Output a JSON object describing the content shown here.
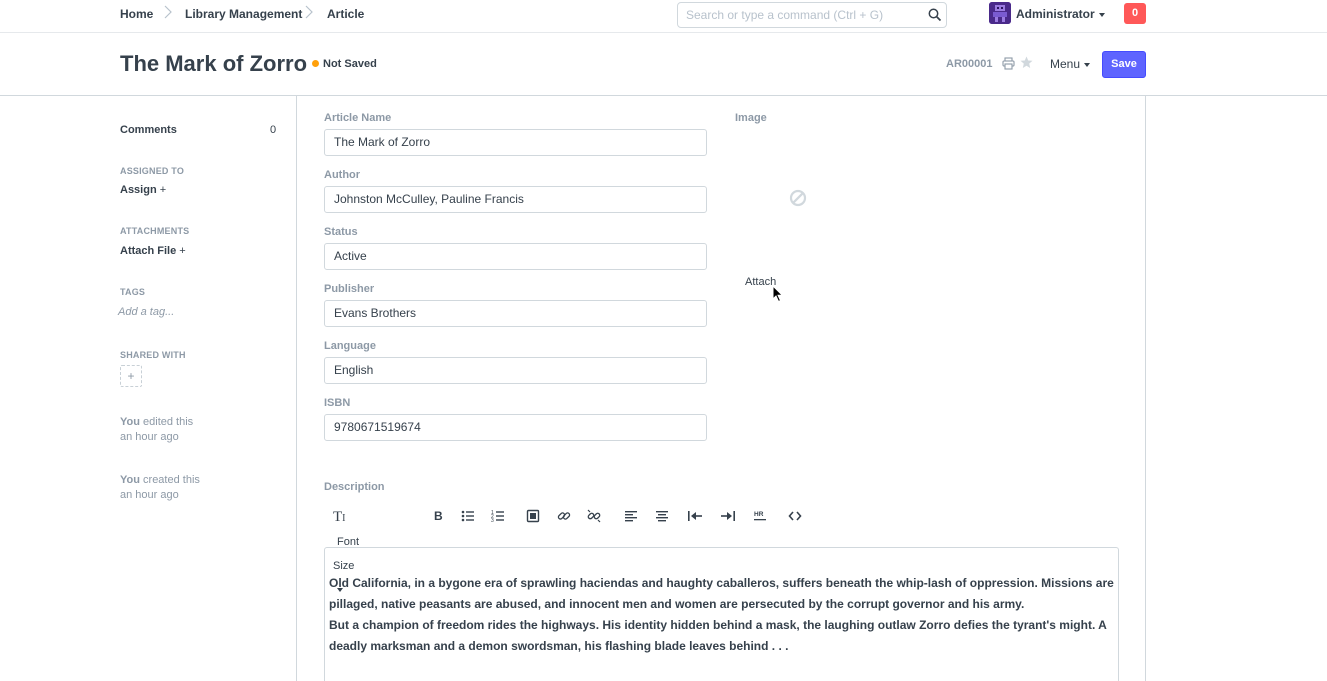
{
  "navbar": {
    "breadcrumbs": [
      "Home",
      "Library Management",
      "Article"
    ],
    "search_placeholder": "Search or type a command (Ctrl + G)",
    "user_name": "Administrator",
    "notification_count": "0"
  },
  "page_head": {
    "title": "The Mark of Zorro",
    "indicator": "Not Saved",
    "doc_id": "AR00001",
    "menu_label": "Menu",
    "save_label": "Save"
  },
  "sidebar": {
    "comments_label": "Comments",
    "comments_count": "0",
    "assigned_to_label": "ASSIGNED TO",
    "assign_label": "Assign",
    "attachments_label": "ATTACHMENTS",
    "attach_file_label": "Attach File",
    "tags_label": "TAGS",
    "add_tag_label": "Add a tag...",
    "shared_with_label": "SHARED WITH",
    "share_add": "+",
    "activity": [
      {
        "user": "You",
        "action": "edited this",
        "time": "an hour ago"
      },
      {
        "user": "You",
        "action": "created this",
        "time": "an hour ago"
      }
    ]
  },
  "form": {
    "fields": [
      {
        "label": "Article Name",
        "value": "The Mark of Zorro"
      },
      {
        "label": "Author",
        "value": "Johnston McCulley, Pauline Francis"
      },
      {
        "label": "Status",
        "value": "Active"
      },
      {
        "label": "Publisher",
        "value": "Evans Brothers"
      },
      {
        "label": "Language",
        "value": "English"
      },
      {
        "label": "ISBN",
        "value": "9780671519674"
      }
    ],
    "image_label": "Image",
    "attach_label": "Attach",
    "description_label": "Description",
    "toolbar": {
      "font_size_label": "Font Size"
    },
    "description_paragraphs": [
      "Old California, in a bygone era of sprawling haciendas and haughty caballeros, suffers beneath the whip-lash of oppression. Missions are pillaged, native peasants are abused, and innocent men and women are persecuted by the corrupt governor and his army.",
      "But a champion of freedom rides the highways. His identity hidden behind a mask, the laughing outlaw Zorro defies the tyrant's might. A deadly marksman and a demon swordsman, his flashing blade leaves behind . . ."
    ]
  },
  "colors": {
    "primary": "#5e64ff",
    "danger": "#ff5858",
    "warning": "#ffa00a",
    "text": "#36414c",
    "muted": "#8d99a6",
    "border": "#d1d8dd"
  }
}
